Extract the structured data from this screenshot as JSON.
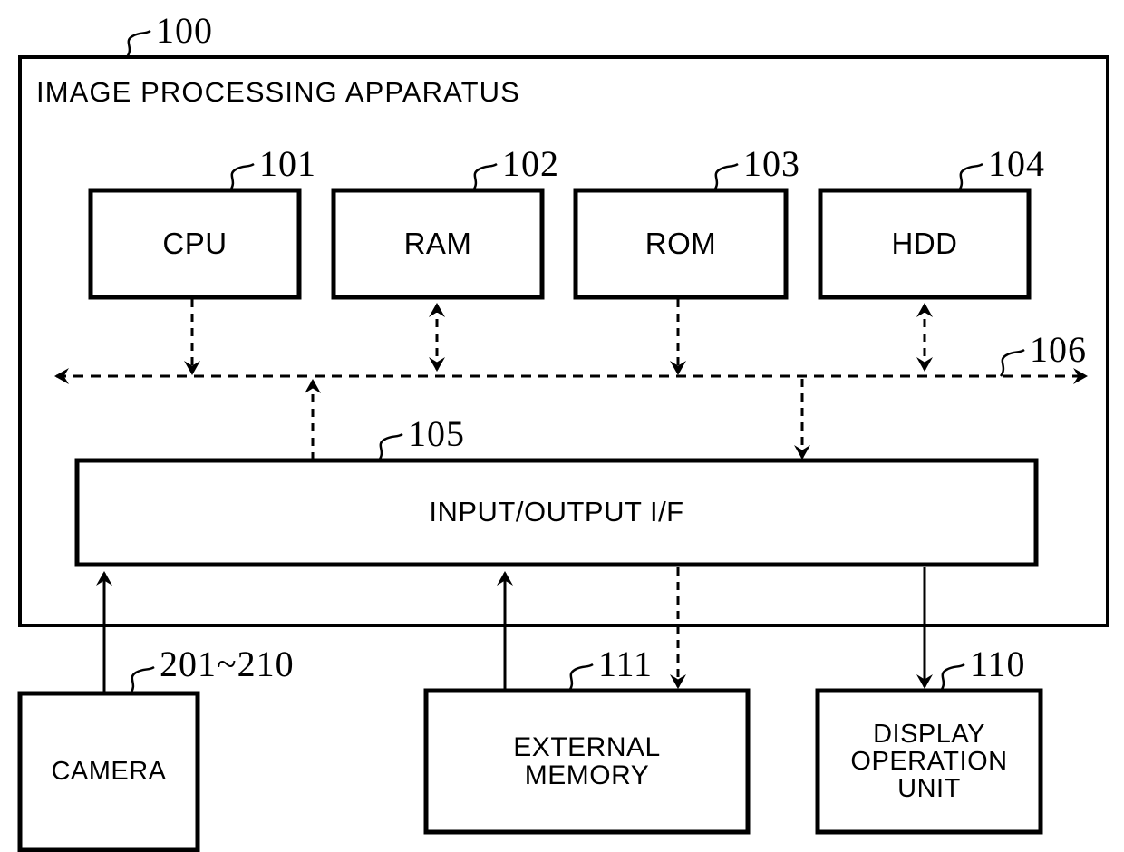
{
  "figure": {
    "apparatus": {
      "title": "IMAGE PROCESSING APPARATUS",
      "ref": "100"
    },
    "blocks": [
      {
        "key": "cpu",
        "label": "CPU",
        "ref": "101"
      },
      {
        "key": "ram",
        "label": "RAM",
        "ref": "102"
      },
      {
        "key": "rom",
        "label": "ROM",
        "ref": "103"
      },
      {
        "key": "hdd",
        "label": "HDD",
        "ref": "104"
      },
      {
        "key": "io",
        "label": "INPUT/OUTPUT I/F",
        "ref": "105"
      },
      {
        "key": "bus",
        "label": "",
        "ref": "106"
      },
      {
        "key": "camera",
        "label": "CAMERA",
        "ref": "201~210"
      },
      {
        "key": "extmem",
        "label": "EXTERNAL\nMEMORY",
        "ref": "111"
      },
      {
        "key": "display",
        "label": "DISPLAY\nOPERATION\nUNIT",
        "ref": "110"
      }
    ],
    "colors": {
      "line": "#000000",
      "background": "#ffffff"
    }
  }
}
